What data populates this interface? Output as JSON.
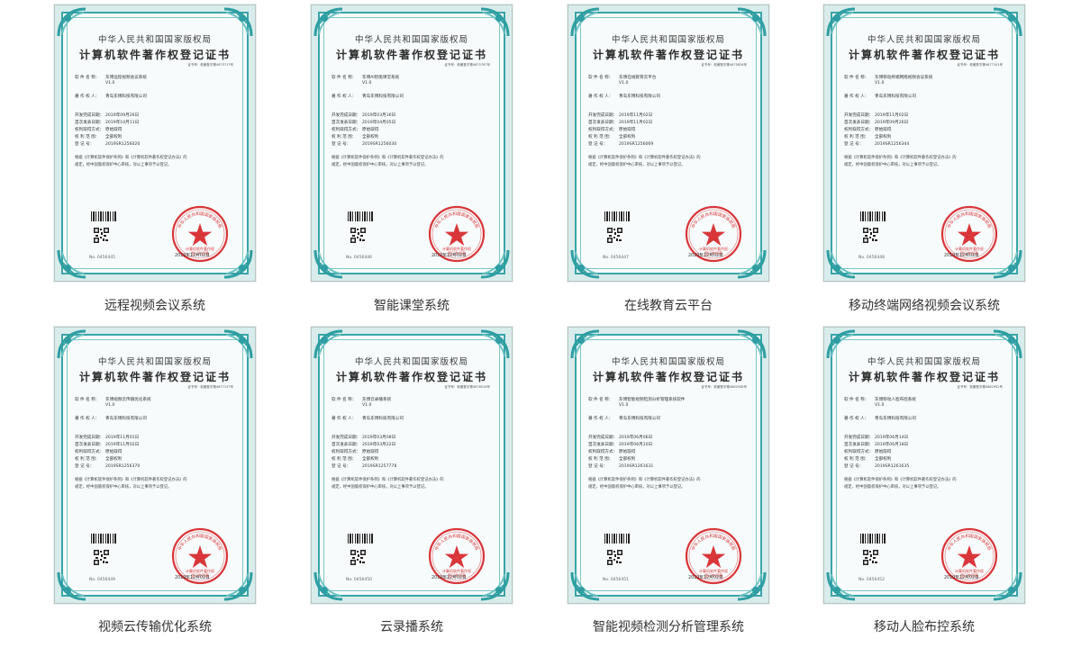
{
  "certificates": [
    {
      "caption": "远程视频会议系统",
      "header": "中华人民共和国国家版权局",
      "title": "计算机软件著作权登记证书",
      "cert_no": "证书号：软著登字第4675717号",
      "software_name": "东博远程视频会议系统",
      "version": "V1.0",
      "owner": "青岛东博科技有限公司",
      "dev_date": "2019年09月26日",
      "pub_date": "2019年10月11日",
      "method": "原始取得",
      "scope": "全部权利",
      "reg_no": "2019SR1256020",
      "para1": "根据《计算机软件保护条例》和《计算机软件著作权登记办法》的",
      "para2": "规定，经中国版权保护中心审核，对以上事项予以登记。",
      "no": "No. 0456445",
      "date": "2019年12月02日",
      "seal_text": "中华人民共和国国家版权局",
      "seal_sub1": "计算机软件著作权",
      "seal_sub2": "登记专用章"
    },
    {
      "caption": "智能课堂系统",
      "header": "中华人民共和国国家版权局",
      "title": "计算机软件著作权登记证书",
      "cert_no": "证书号：软著登字第4675767号",
      "software_name": "东博AI智能课堂系统",
      "version": "V1.0",
      "owner": "青岛东博科技有限公司",
      "dev_date": "2019年03月16日",
      "pub_date": "2019年04月05日",
      "method": "原始取得",
      "scope": "全部权利",
      "reg_no": "2019SR1256030",
      "para1": "根据《计算机软件保护条例》和《计算机软件著作权登记办法》的",
      "para2": "规定，经中国版权保护中心审核，对以上事项予以登记。",
      "no": "No. 0456446",
      "date": "2019年12月02日",
      "seal_text": "中华人民共和国国家版权局",
      "seal_sub1": "计算机软件著作权",
      "seal_sub2": "登记专用章"
    },
    {
      "caption": "在线教育云平台",
      "header": "中华人民共和国国家版权局",
      "title": "计算机软件著作权登记证书",
      "cert_no": "证书号：软著登字第4675826号",
      "software_name": "东博在线教育云平台",
      "version": "V1.0",
      "owner": "青岛东博科技有限公司",
      "dev_date": "2019年11月02日",
      "pub_date": "2019年11月02日",
      "method": "原始取得",
      "scope": "全部权利",
      "reg_no": "2019SR1256069",
      "para1": "根据《计算机软件保护条例》和《计算机软件著作权登记办法》的",
      "para2": "规定，经中国版权保护中心审核，对以上事项予以登记。",
      "no": "No. 0456447",
      "date": "2019年12月02日",
      "seal_text": "中华人民共和国国家版权局",
      "seal_sub1": "计算机软件著作权",
      "seal_sub2": "登记专用章"
    },
    {
      "caption": "移动终端网络视频会议系统",
      "header": "中华人民共和国国家版权局",
      "title": "计算机软件著作权登记证书",
      "cert_no": "证书号：软著登字第4677101号",
      "software_name": "东博移动终端网络视频会议系统",
      "version": "V1.0",
      "owner": "青岛东博科技有限公司",
      "dev_date": "2019年11月02日",
      "pub_date": "2019年09月26日",
      "method": "原始取得",
      "scope": "全部权利",
      "reg_no": "2019SR1256344",
      "para1": "根据《计算机软件保护条例》和《计算机软件著作权登记办法》的",
      "para2": "规定，经中国版权保护中心审核，对以上事项予以登记。",
      "no": "No. 0456448",
      "date": "2019年12月02日",
      "seal_text": "中华人民共和国国家版权局",
      "seal_sub1": "计算机软件著作权",
      "seal_sub2": "登记专用章"
    },
    {
      "caption": "视频云传输优化系统",
      "header": "中华人民共和国国家版权局",
      "title": "计算机软件著作权登记证书",
      "cert_no": "证书号：软著登字第4677137号",
      "software_name": "东博视频云传输优化系统",
      "version": "V1.0",
      "owner": "青岛东博科技有限公司",
      "dev_date": "2019年11月01日",
      "pub_date": "2019年11月02日",
      "method": "原始取得",
      "scope": "全部权利",
      "reg_no": "2019SR1256370",
      "para1": "根据《计算机软件保护条例》和《计算机软件著作权登记办法》的",
      "para2": "规定，经中国版权保护中心审核，对以上事项予以登记。",
      "no": "No. 0456449",
      "date": "2019年12月02日",
      "seal_text": "中华人民共和国国家版权局",
      "seal_sub1": "计算机软件著作权",
      "seal_sub2": "登记专用章"
    },
    {
      "caption": "云录播系统",
      "header": "中华人民共和国国家版权局",
      "title": "计算机软件著作权登记证书",
      "cert_no": "证书号：软著登字第4678516号",
      "software_name": "东博云录播系统",
      "version": "V1.0",
      "owner": "青岛东博科技有限公司",
      "dev_date": "2019年03月08日",
      "pub_date": "2019年03月22日",
      "method": "原始取得",
      "scope": "全部权利",
      "reg_no": "2019SR1257778",
      "para1": "根据《计算机软件保护条例》和《计算机软件著作权登记办法》的",
      "para2": "规定，经中国版权保护中心审核，对以上事项予以登记。",
      "no": "No. 0456450",
      "date": "2019年12月02日",
      "seal_text": "中华人民共和国国家版权局",
      "seal_sub1": "计算机软件著作权",
      "seal_sub2": "登记专用章"
    },
    {
      "caption": "智能视频检测分析管理系统",
      "header": "中华人民共和国国家版权局",
      "title": "计算机软件著作权登记证书",
      "cert_no": "证书号：软著登字第4682948号",
      "software_name": "东博智能视频检测分析管理系统软件",
      "version": "V1.0",
      "owner": "青岛东博科技有限公司",
      "dev_date": "2019年06月06日",
      "pub_date": "2019年06月20日",
      "method": "原始取得",
      "scope": "全部权利",
      "reg_no": "2019SR1261631",
      "para1": "根据《计算机软件保护条例》和《计算机软件著作权登记办法》的",
      "para2": "规定，经中国版权保护中心审核，对以上事项予以登记。",
      "no": "No. 0456451",
      "date": "2019年12月02日",
      "seal_text": "中华人民共和国国家版权局",
      "seal_sub1": "计算机软件著作权",
      "seal_sub2": "登记专用章"
    },
    {
      "caption": "移动人脸布控系统",
      "header": "中华人民共和国国家版权局",
      "title": "计算机软件著作权登记证书",
      "cert_no": "证书号：软著登字第4682952号",
      "software_name": "东博移动人脸布控系统",
      "version": "V1.0",
      "owner": "青岛东博科技有限公司",
      "dev_date": "2019年06月14日",
      "pub_date": "2019年06月18日",
      "method": "原始取得",
      "scope": "全部权利",
      "reg_no": "2019SR1261635",
      "para1": "根据《计算机软件保护条例》和《计算机软件著作权登记办法》的",
      "para2": "规定，经中国版权保护中心审核，对以上事项予以登记。",
      "no": "No. 0456452",
      "date": "2019年12月02日",
      "seal_text": "中华人民共和国国家版权局",
      "seal_sub1": "计算机软件著作权",
      "seal_sub2": "登记专用章"
    }
  ],
  "labels": {
    "software_name": "软 件 名 称：",
    "owner": "著 作 权 人：",
    "dev_date": "开发完成日期：",
    "pub_date": "首次发表日期：",
    "method": "权利取得方式：",
    "scope": "权 利 范 围：",
    "reg_no": "登    记    号："
  },
  "colors": {
    "frame": "#3aa5a8",
    "seal": "#d9363a",
    "paper": "#f7fbfb"
  }
}
